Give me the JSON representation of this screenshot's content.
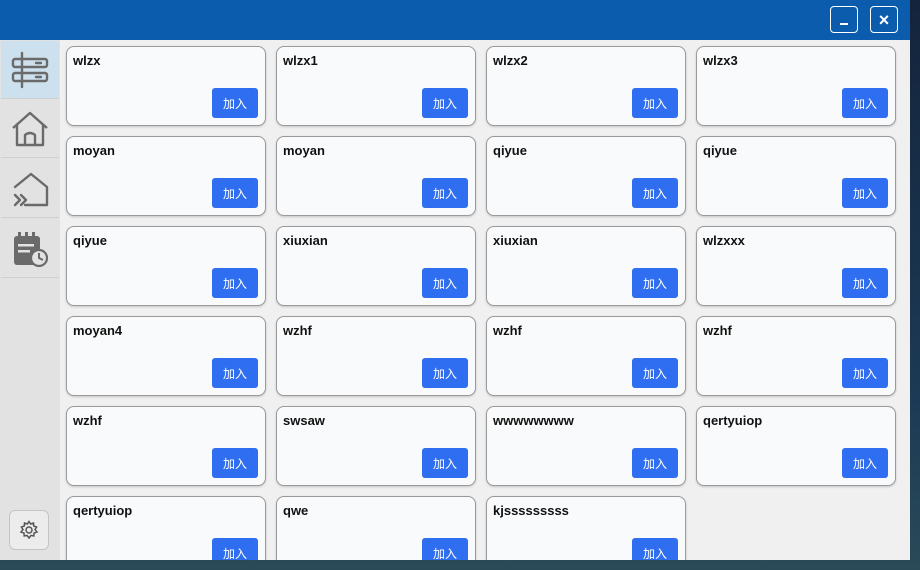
{
  "window": {
    "controls": {
      "minimize_label": "_",
      "close_label": "×"
    }
  },
  "sidebar": {
    "items": [
      {
        "icon": "server-icon",
        "active": true
      },
      {
        "icon": "home-icon",
        "active": false
      },
      {
        "icon": "home-enter-icon",
        "active": false
      },
      {
        "icon": "calendar-clock-icon",
        "active": false
      }
    ],
    "settings_icon": "gear-icon"
  },
  "rooms": [
    {
      "name": "wlzx",
      "button": "加入"
    },
    {
      "name": "wlzx1",
      "button": "加入"
    },
    {
      "name": "wlzx2",
      "button": "加入"
    },
    {
      "name": "wlzx3",
      "button": "加入"
    },
    {
      "name": "moyan",
      "button": "加入"
    },
    {
      "name": "moyan",
      "button": "加入"
    },
    {
      "name": "qiyue",
      "button": "加入"
    },
    {
      "name": "qiyue",
      "button": "加入"
    },
    {
      "name": "qiyue",
      "button": "加入"
    },
    {
      "name": "xiuxian",
      "button": "加入"
    },
    {
      "name": "xiuxian",
      "button": "加入"
    },
    {
      "name": "wlzxxx",
      "button": "加入"
    },
    {
      "name": "moyan4",
      "button": "加入"
    },
    {
      "name": "wzhf",
      "button": "加入"
    },
    {
      "name": "wzhf",
      "button": "加入"
    },
    {
      "name": "wzhf",
      "button": "加入"
    },
    {
      "name": "wzhf",
      "button": "加入"
    },
    {
      "name": "swsaw",
      "button": "加入"
    },
    {
      "name": "wwwwwwww",
      "button": "加入"
    },
    {
      "name": "qertyuiop",
      "button": "加入"
    },
    {
      "name": "qertyuiop",
      "button": "加入"
    },
    {
      "name": "qwe",
      "button": "加入"
    },
    {
      "name": "kjsssssssss",
      "button": "加入"
    }
  ],
  "colors": {
    "titlebar": "#0b5cad",
    "accent_button": "#2f6ef0",
    "active_sidebar": "#cde0ee"
  }
}
